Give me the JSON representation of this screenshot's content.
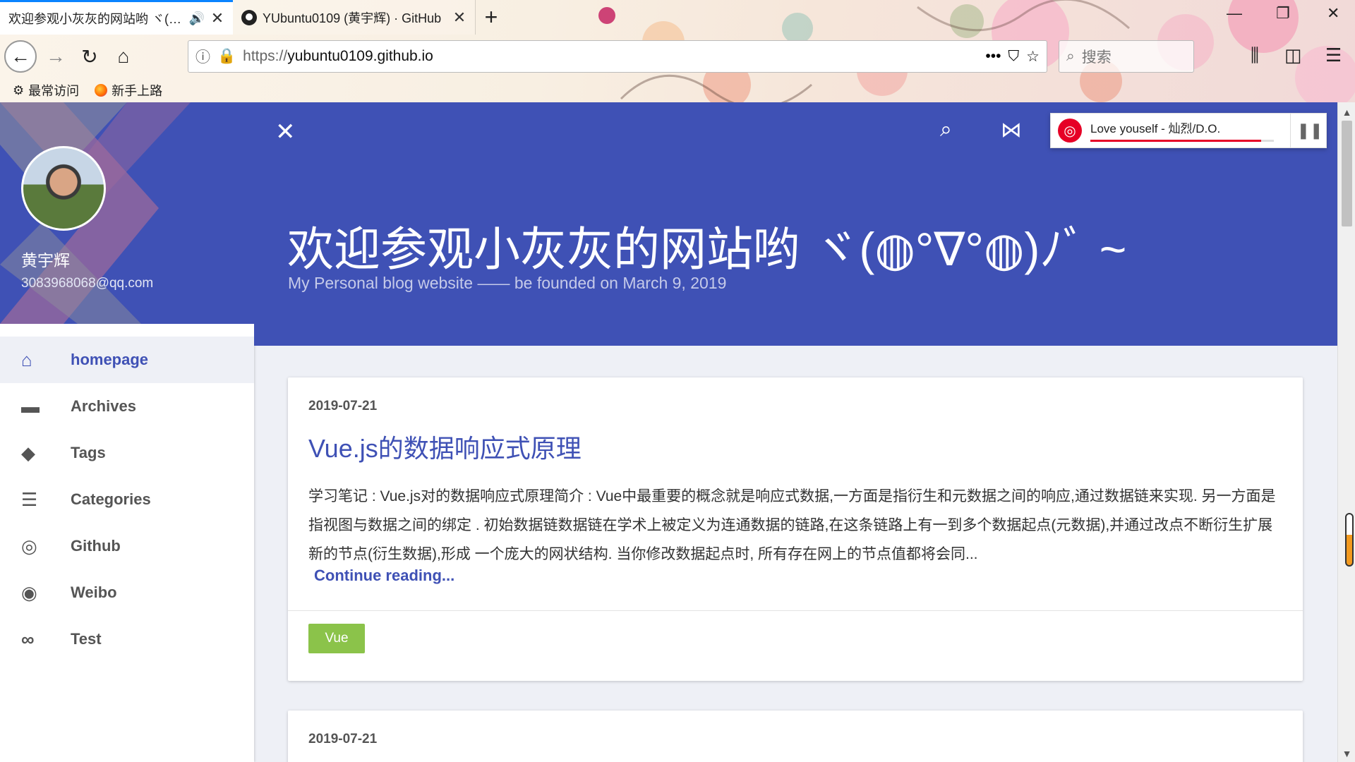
{
  "browser": {
    "tabs": [
      {
        "title": "欢迎参观小灰灰的网站哟 ヾ(◍°",
        "active": true
      },
      {
        "title": "YUbuntu0109 (黄宇辉) · GitHub",
        "active": false
      }
    ],
    "url": {
      "protocol": "https://",
      "host": "yubuntu0109.github.io"
    },
    "search_placeholder": "搜索",
    "bookmarks": [
      "最常访问",
      "新手上路"
    ]
  },
  "sidebar": {
    "name": "黄宇辉",
    "email": "3083968068@qq.com",
    "menu": [
      {
        "label": "homepage",
        "icon": "home-icon",
        "active": true
      },
      {
        "label": "Archives",
        "icon": "archive-icon",
        "active": false
      },
      {
        "label": "Tags",
        "icon": "tags-icon",
        "active": false
      },
      {
        "label": "Categories",
        "icon": "list-icon",
        "active": false
      },
      {
        "label": "Github",
        "icon": "github-icon",
        "active": false
      },
      {
        "label": "Weibo",
        "icon": "weibo-icon",
        "active": false
      },
      {
        "label": "Test",
        "icon": "link-icon",
        "active": false
      }
    ]
  },
  "hero": {
    "title": "欢迎参观小灰灰的网站哟 ヾ(◍°∇°◍)ﾉﾞ ~",
    "subtitle": "My Personal blog website —— be founded on March 9, 2019"
  },
  "player": {
    "track": "Love youself - 灿烈/D.O.",
    "progress": 0.93
  },
  "posts": [
    {
      "date": "2019-07-21",
      "title": "Vue.js的数据响应式原理",
      "excerpt": "学习笔记 : Vue.js对的数据响应式原理简介 : Vue中最重要的概念就是响应式数据,一方面是指衍生和元数据之间的响应,通过数据链来实现. 另一方面是指视图与数据之间的绑定 . 初始数据链数据链在学术上被定义为连通数据的链路,在这条链路上有一到多个数据起点(元数据),并通过改点不断衍生扩展新的节点(衍生数据),形成 一个庞大的网状结构. 当你修改数据起点时, 所有存在网上的节点值都将会同...",
      "more": "Continue reading...",
      "tag": "Vue"
    },
    {
      "date": "2019-07-21"
    }
  ],
  "colors": {
    "primary": "#3f51b5",
    "tag": "#8bc34a",
    "netease": "#e60026"
  }
}
